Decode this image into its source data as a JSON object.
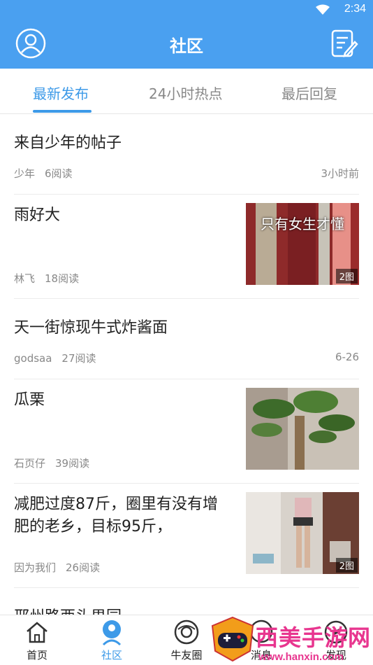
{
  "status_bar": {
    "time": "2:34",
    "icons": [
      "wifi-icon",
      "cellular-signal-icon",
      "battery-icon"
    ]
  },
  "header": {
    "title": "社区",
    "left_icon": "user-avatar-icon",
    "right_icon": "compose-post-icon"
  },
  "colors": {
    "primary": "#4aa0f0",
    "accent": "#3d9ae8",
    "watermark": "#e8368f"
  },
  "tabs": [
    {
      "label": "最新发布",
      "active": true
    },
    {
      "label": "24小时热点",
      "active": false
    },
    {
      "label": "最后回复",
      "active": false
    }
  ],
  "posts": [
    {
      "title": "来自少年的帖子",
      "author": "少年",
      "reads": "6阅读",
      "time": "3小时前"
    },
    {
      "title": "雨好大",
      "author": "林飞",
      "reads": "18阅读",
      "image_text": "只有女生才懂",
      "image_count": "2图"
    },
    {
      "title": "天一街惊现牛式炸酱面",
      "author": "godsaa",
      "reads": "27阅读",
      "time": "6-26"
    },
    {
      "title": "瓜栗",
      "author": "石页仔",
      "reads": "39阅读"
    },
    {
      "title_line1": "减肥过度87斤，圈里有没有增",
      "title_line2": "肥的老乡，目标95斤，",
      "author": "因为我们",
      "reads": "26阅读",
      "image_count": "2图"
    },
    {
      "title": "邢州路西头男园"
    }
  ],
  "tabbar": [
    {
      "label": "首页",
      "icon": "home-icon",
      "active": false
    },
    {
      "label": "社区",
      "icon": "community-icon",
      "active": true
    },
    {
      "label": "牛友圈",
      "icon": "friends-circle-icon",
      "active": false
    },
    {
      "label": "消息",
      "icon": "message-icon",
      "active": false
    },
    {
      "label": "发现",
      "icon": "discover-icon",
      "active": false
    }
  ],
  "watermark": {
    "text": "西美手游网",
    "url": "www.hanxin.com"
  }
}
